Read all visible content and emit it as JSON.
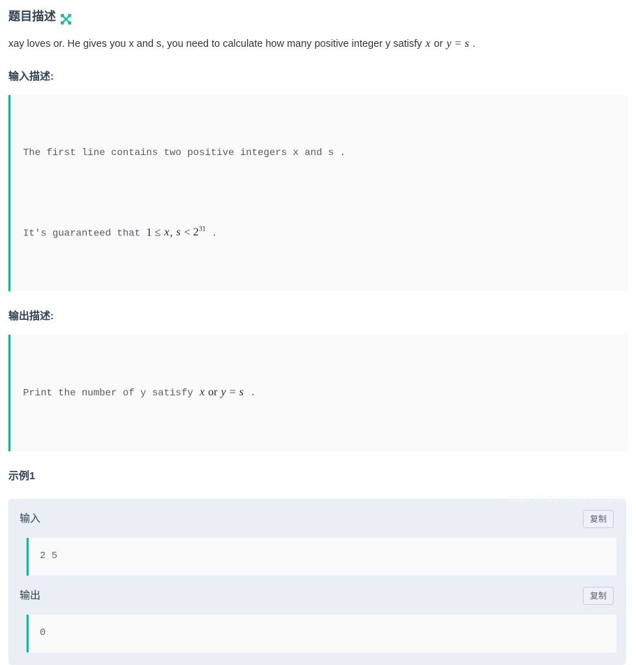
{
  "problem": {
    "title": "题目描述",
    "expand_icon": "expand-arrows-icon",
    "description_prefix": "xay loves or. He gives you x and s, you need to calculate how many positive integer y satisfy ",
    "description_math_x": "x",
    "description_mid": " or ",
    "description_math_eq_y": "y",
    "description_math_eq_rel": " = ",
    "description_math_eq_s": "s",
    "description_suffix": " ."
  },
  "input_section": {
    "heading": "输入描述:",
    "line1": "The first line contains two positive integers x and s .",
    "line2_prefix": "It's guaranteed that ",
    "line2_math_one": "1",
    "line2_math_le": " ≤ ",
    "line2_math_x": "x",
    "line2_math_comma": ", ",
    "line2_math_s": "s",
    "line2_math_lt": " < ",
    "line2_math_base": "2",
    "line2_math_exp": "31",
    "line2_suffix": " ."
  },
  "output_section": {
    "heading": "输出描述:",
    "line_prefix": "Print the number of y satisfy ",
    "line_math_x": "x",
    "line_mid": " or ",
    "line_math_y": "y",
    "line_math_rel": " = ",
    "line_math_s": "s",
    "line_suffix": " ."
  },
  "example": {
    "heading": "示例1",
    "input": {
      "label": "输入",
      "copy_label": "复制",
      "value": "2 5"
    },
    "output": {
      "label": "输出",
      "copy_label": "复制",
      "value": "0"
    }
  },
  "watermark": {
    "text": "https://blog.csdn.net/ojzha"
  },
  "colors": {
    "accent_teal": "#22b198",
    "heading": "#2f4154",
    "body_text": "#333333",
    "card_bg": "#eaeef5",
    "code_bg": "#fafafa",
    "code_text": "#5d6472",
    "button_border": "#c9cfda"
  }
}
